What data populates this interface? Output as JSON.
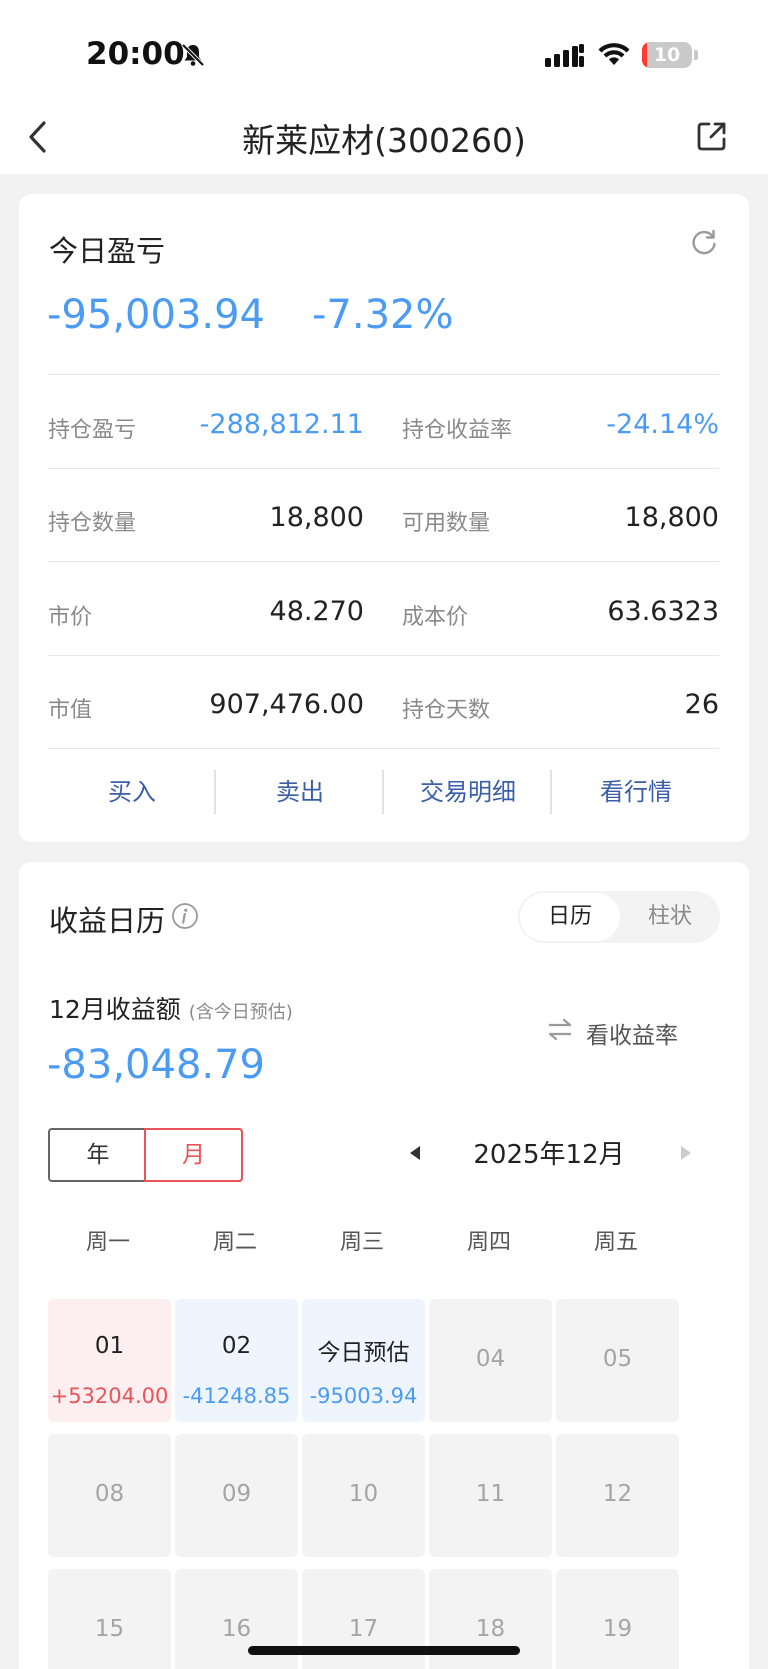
{
  "status": {
    "time": "20:00",
    "battery": "10",
    "battery_level": 0.1
  },
  "nav": {
    "title": "新莱应材(300260)"
  },
  "today": {
    "title": "今日盈亏",
    "amount": "-95,003.94",
    "pct": "-7.32%"
  },
  "stats": [
    {
      "left_label": "持仓盈亏",
      "left_value": "-288,812.11",
      "right_label": "持仓收益率",
      "right_value": "-24.14%"
    },
    {
      "left_label": "持仓数量",
      "left_value": "18,800",
      "right_label": "可用数量",
      "right_value": "18,800"
    },
    {
      "left_label": "市价",
      "left_value": "48.270",
      "right_label": "成本价",
      "right_value": "63.6323"
    },
    {
      "left_label": "市值",
      "left_value": "907,476.00",
      "right_label": "持仓天数",
      "right_value": "26"
    }
  ],
  "actions": [
    "买入",
    "卖出",
    "交易明细",
    "看行情"
  ],
  "calendar": {
    "title": "收益日历",
    "toggle_on": "日历",
    "toggle_off": "柱状",
    "month_label": "12月收益额",
    "month_note": "(含今日预估)",
    "month_amount": "-83,048.79",
    "view_rate": "看收益率",
    "seg_year": "年",
    "seg_month": "月",
    "current_month": "2025年12月",
    "weekdays": [
      "周一",
      "周二",
      "周三",
      "周四",
      "周五"
    ],
    "days": [
      {
        "day": "01",
        "value": "+53204.00",
        "kind": "profit"
      },
      {
        "day": "02",
        "value": "-41248.85",
        "kind": "loss"
      },
      {
        "day": "今日预估",
        "value": "-95003.94",
        "kind": "loss"
      },
      {
        "day": "04",
        "value": "",
        "kind": "none"
      },
      {
        "day": "05",
        "value": "",
        "kind": "none"
      },
      {
        "day": "08",
        "value": "",
        "kind": "none"
      },
      {
        "day": "09",
        "value": "",
        "kind": "none"
      },
      {
        "day": "10",
        "value": "",
        "kind": "none"
      },
      {
        "day": "11",
        "value": "",
        "kind": "none"
      },
      {
        "day": "12",
        "value": "",
        "kind": "none"
      },
      {
        "day": "15",
        "value": "",
        "kind": "none"
      },
      {
        "day": "16",
        "value": "",
        "kind": "none"
      },
      {
        "day": "17",
        "value": "",
        "kind": "none"
      },
      {
        "day": "18",
        "value": "",
        "kind": "none"
      },
      {
        "day": "19",
        "value": "",
        "kind": "none"
      }
    ]
  },
  "colors": {
    "loss_blue": "#4b9bf5",
    "profit_red": "#e9545a",
    "action_blue": "#3a5ea8"
  }
}
